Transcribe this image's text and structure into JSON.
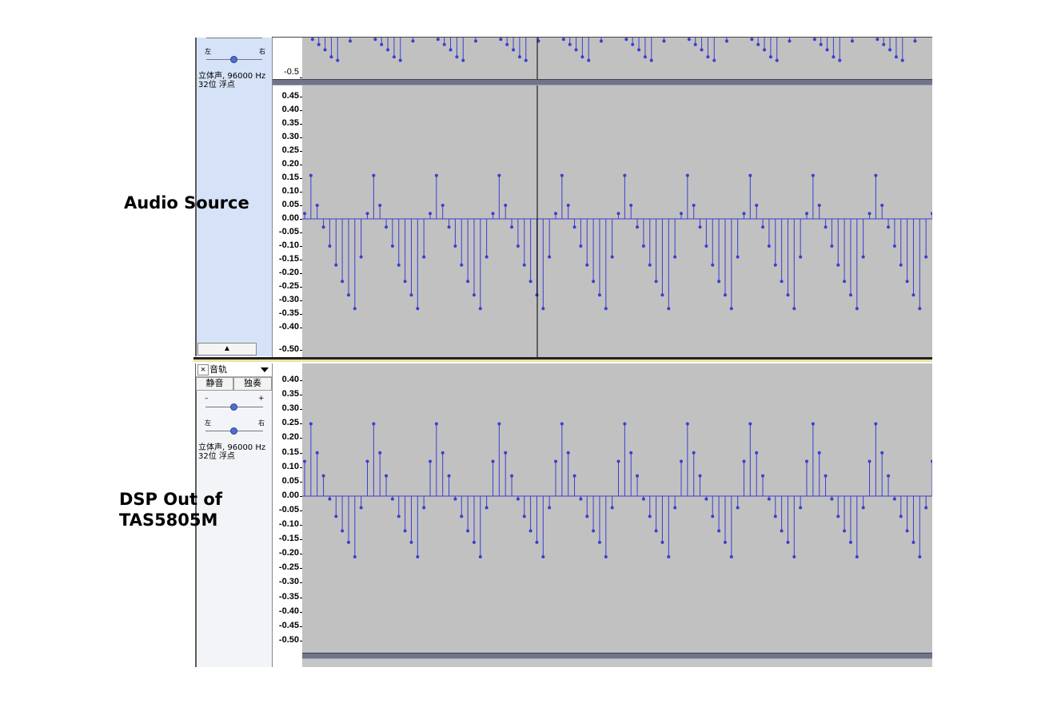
{
  "annotations": {
    "audio_source": "Audio Source",
    "dsp_out": "DSP Out of\nTAS5805M"
  },
  "track1": {
    "pan_left": "左",
    "pan_right": "右",
    "format_line1": "立体声, 96000 Hz",
    "format_line2": "32位 浮点",
    "top_ruler_label": "-0.5",
    "collapse_icon": "▲",
    "ruler_labels": [
      "0.45",
      "0.40",
      "0.35",
      "0.30",
      "0.25",
      "0.20",
      "0.15",
      "0.10",
      "0.05",
      "0.00",
      "-0.05",
      "-0.10",
      "-0.15",
      "-0.20",
      "-0.25",
      "-0.30",
      "-0.35",
      "-0.40",
      "-0.50"
    ]
  },
  "track2": {
    "close_label": "×",
    "name": "音轨",
    "mute_label": "静音",
    "solo_label": "独奏",
    "gain_minus": "–",
    "gain_plus": "+",
    "pan_left": "左",
    "pan_right": "右",
    "format_line1": "立体声, 96000 Hz",
    "format_line2": "32位 浮点",
    "ruler_labels": [
      "0.40",
      "0.35",
      "0.30",
      "0.25",
      "0.20",
      "0.15",
      "0.10",
      "0.05",
      "0.00",
      "-0.05",
      "-0.10",
      "-0.15",
      "-0.20",
      "-0.25",
      "-0.30",
      "-0.35",
      "-0.40",
      "-0.45",
      "-0.50"
    ]
  },
  "colors": {
    "waveform": "#3a3fd0",
    "plot_background": "#c1c1c1",
    "track1_panel": "#d6e2f7",
    "track2_panel": "#f3f4f8"
  },
  "chart_data": [
    {
      "type": "stem",
      "name": "Audio Source",
      "ylim": [
        -0.5,
        0.47
      ],
      "period_samples": 10,
      "period_values": [
        0.02,
        0.16,
        0.05,
        -0.03,
        -0.1,
        -0.17,
        -0.23,
        -0.28,
        -0.33,
        -0.14
      ],
      "cycles": 10
    },
    {
      "type": "stem",
      "name": "DSP Out of TAS5805M",
      "ylim": [
        -0.5,
        0.4
      ],
      "period_samples": 10,
      "period_values": [
        0.12,
        0.25,
        0.15,
        0.07,
        -0.01,
        -0.07,
        -0.12,
        -0.16,
        -0.21,
        -0.04
      ],
      "cycles": 10
    },
    {
      "type": "stem",
      "name": "Audio Source (upper partial view)",
      "ylim": [
        -0.5,
        -0.35
      ],
      "period_samples": 10,
      "period_values": [
        null,
        -0.36,
        -0.39,
        -0.42,
        -0.46,
        -0.48,
        null,
        -0.37,
        null,
        null
      ],
      "cycles": 10
    }
  ]
}
